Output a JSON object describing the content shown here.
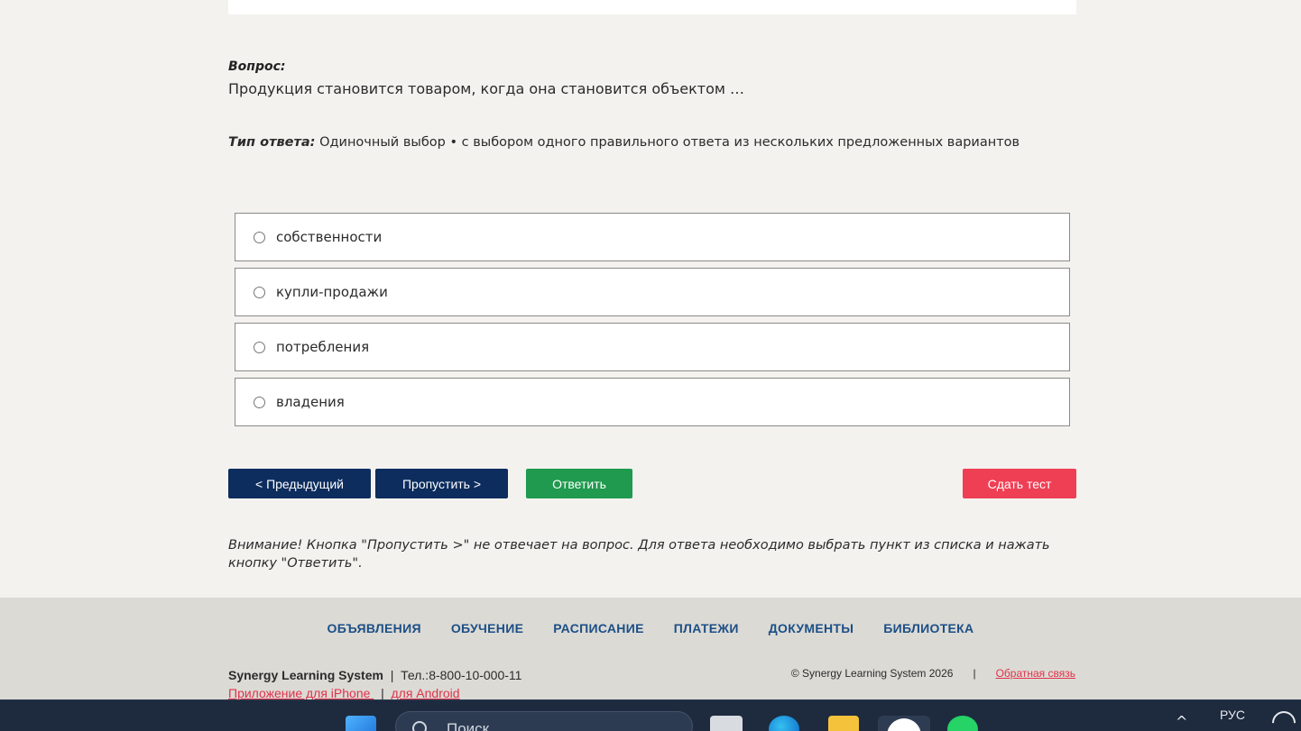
{
  "question": {
    "label": "Вопрос:",
    "text": "Продукция становится товаром, когда она становится объектом …"
  },
  "answer_type": {
    "label": "Тип ответа:",
    "value": " Одиночный выбор • с выбором одного правильного ответа из нескольких предложенных вариантов"
  },
  "options": [
    {
      "label": "собственности",
      "selected": false
    },
    {
      "label": "купли-продажи",
      "selected": false
    },
    {
      "label": "потребления",
      "selected": false
    },
    {
      "label": "владения",
      "selected": false
    }
  ],
  "buttons": {
    "prev": "< Предыдущий",
    "skip": "Пропустить >",
    "answer": "Ответить",
    "submit": "Сдать тест"
  },
  "colors": {
    "navy": "#0d2d5e",
    "green": "#1f9a4e",
    "red": "#ef3f55",
    "link": "#1c4f86"
  },
  "warning": "Внимание! Кнопка \"Пропустить >\" не отвечает на вопрос. Для ответа необходимо выбрать пункт из списка и нажать кнопку \"Ответить\".",
  "footer": {
    "nav": [
      "ОБЪЯВЛЕНИЯ",
      "ОБУЧЕНИЕ",
      "РАСПИСАНИЕ",
      "ПЛАТЕЖИ",
      "ДОКУМЕНТЫ",
      "БИБЛИОТЕКА"
    ],
    "brand": "Synergy Learning System",
    "sep": "  |  ",
    "phone": "Тел.:8-800-10-000-11",
    "app_iphone": "Приложение для iPhone ",
    "app_sep": "  |  ",
    "app_android": "для Android",
    "copyright": "© Synergy Learning System 2026",
    "right_sep": "|",
    "feedback": "Обратная связь"
  },
  "taskbar": {
    "search_placeholder": "Поиск",
    "lang": "РУС",
    "icons": [
      "windows-start-icon",
      "search-icon",
      "files-icon",
      "edge-icon",
      "folder-icon",
      "yandex-browser-icon",
      "whatsapp-icon",
      "chevron-up-icon",
      "wifi-icon"
    ]
  }
}
